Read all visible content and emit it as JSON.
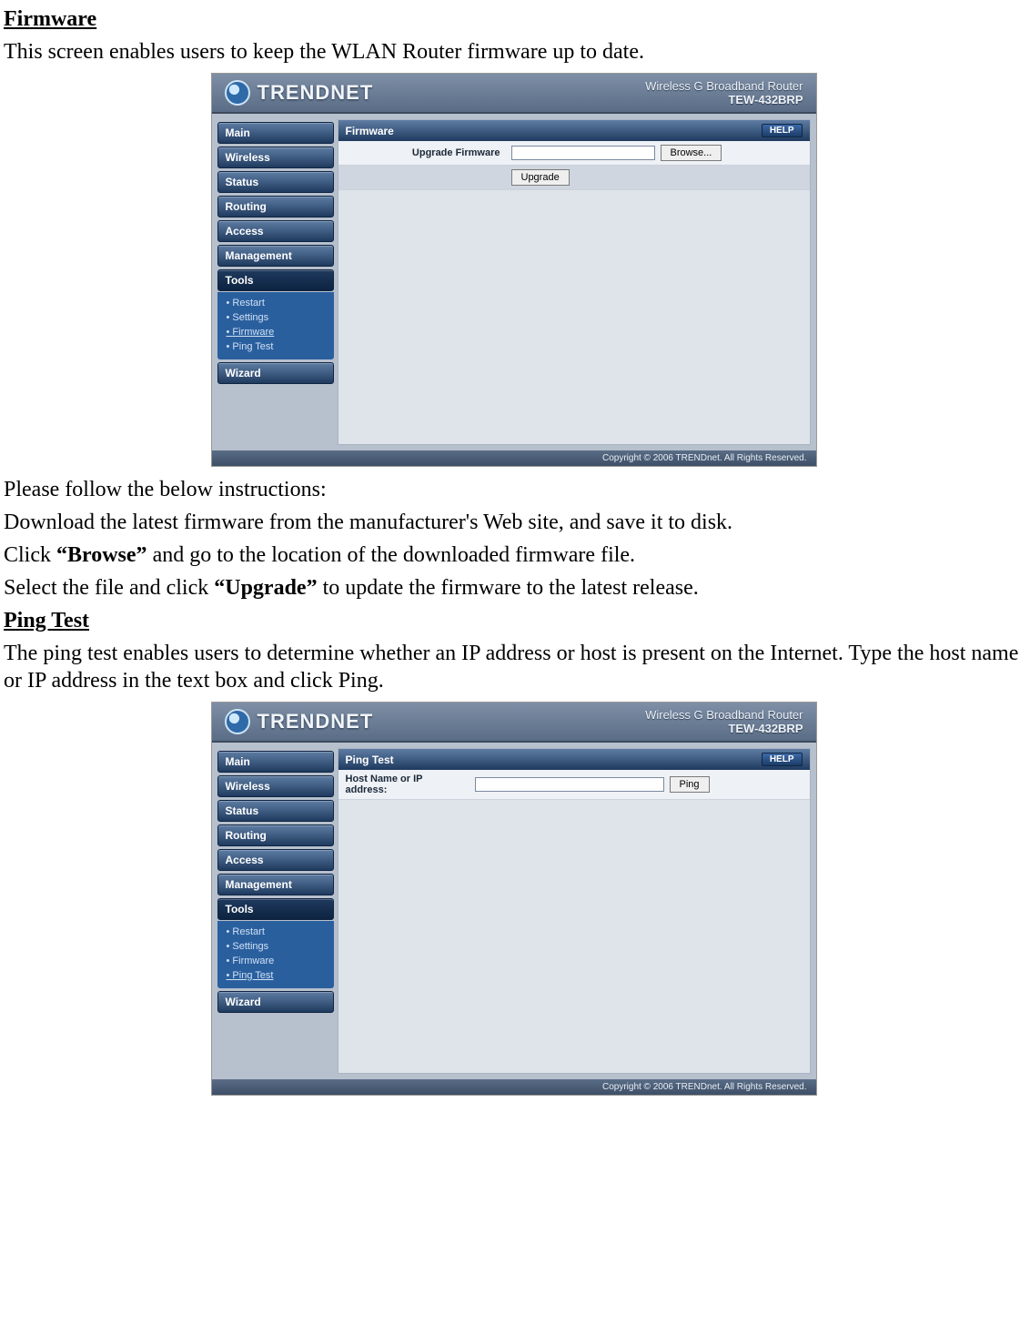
{
  "sections": {
    "firmware": {
      "heading": "Firmware",
      "intro": "This screen enables users to keep the WLAN Router firmware up to date.",
      "instructions_lead": "Please follow the below instructions:",
      "step1": "Download the latest firmware from the manufacturer's Web site, and save it to disk.",
      "step2a": "Click ",
      "step2b": "“Browse”",
      "step2c": " and go to the location of the downloaded firmware file.",
      "step3a": "Select the file and click ",
      "step3b": "“Upgrade”",
      "step3c": " to update the firmware to the latest release."
    },
    "pingtest": {
      "heading": "Ping Test",
      "intro": "The ping test enables users to determine whether an IP address or host is present on the Internet. Type the host name or IP address in the text box and click Ping."
    }
  },
  "router": {
    "brand": "TRENDNET",
    "product_line": "Wireless G Broadband Router",
    "model": "TEW-432BRP",
    "footer": "Copyright © 2006 TRENDnet. All Rights Reserved.",
    "nav": {
      "main": "Main",
      "wireless": "Wireless",
      "status": "Status",
      "routing": "Routing",
      "access": "Access",
      "management": "Management",
      "tools": "Tools",
      "wizard": "Wizard"
    },
    "tools_sub": {
      "restart": "Restart",
      "settings": "Settings",
      "firmware": "Firmware",
      "pingtest": "Ping Test"
    },
    "help": "HELP",
    "firmware_panel": {
      "title": "Firmware",
      "label": "Upgrade Firmware",
      "browse": "Browse...",
      "upgrade": "Upgrade"
    },
    "ping_panel": {
      "title": "Ping Test",
      "label": "Host Name or IP address:",
      "ping": "Ping"
    }
  }
}
